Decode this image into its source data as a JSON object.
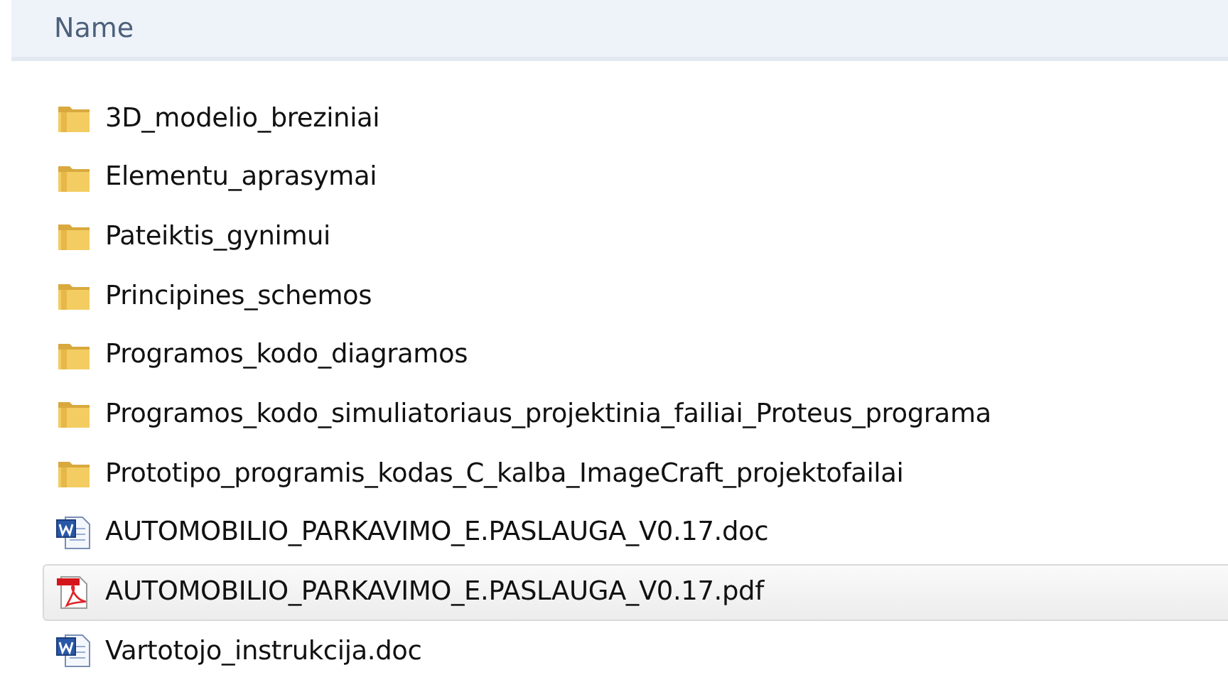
{
  "header": {
    "column": "Name"
  },
  "files": [
    {
      "kind": "folder",
      "name": "3D_modelio_breziniai",
      "selected": false
    },
    {
      "kind": "folder",
      "name": "Elementu_aprasymai",
      "selected": false
    },
    {
      "kind": "folder",
      "name": "Pateiktis_gynimui",
      "selected": false
    },
    {
      "kind": "folder",
      "name": "Principines_schemos",
      "selected": false
    },
    {
      "kind": "folder",
      "name": "Programos_kodo_diagramos",
      "selected": false
    },
    {
      "kind": "folder",
      "name": "Programos_kodo_simuliatoriaus_projektinia_failiai_Proteus_programa",
      "selected": false
    },
    {
      "kind": "folder",
      "name": "Prototipo_programis_kodas_C_kalba_ImageCraft_projektofailai",
      "selected": false
    },
    {
      "kind": "word",
      "name": "AUTOMOBILIO_PARKAVIMO_E.PASLAUGA_V0.17.doc",
      "selected": false
    },
    {
      "kind": "pdf",
      "name": "AUTOMOBILIO_PARKAVIMO_E.PASLAUGA_V0.17.pdf",
      "selected": true
    },
    {
      "kind": "word",
      "name": "Vartotojo_instrukcija.doc",
      "selected": false
    }
  ]
}
